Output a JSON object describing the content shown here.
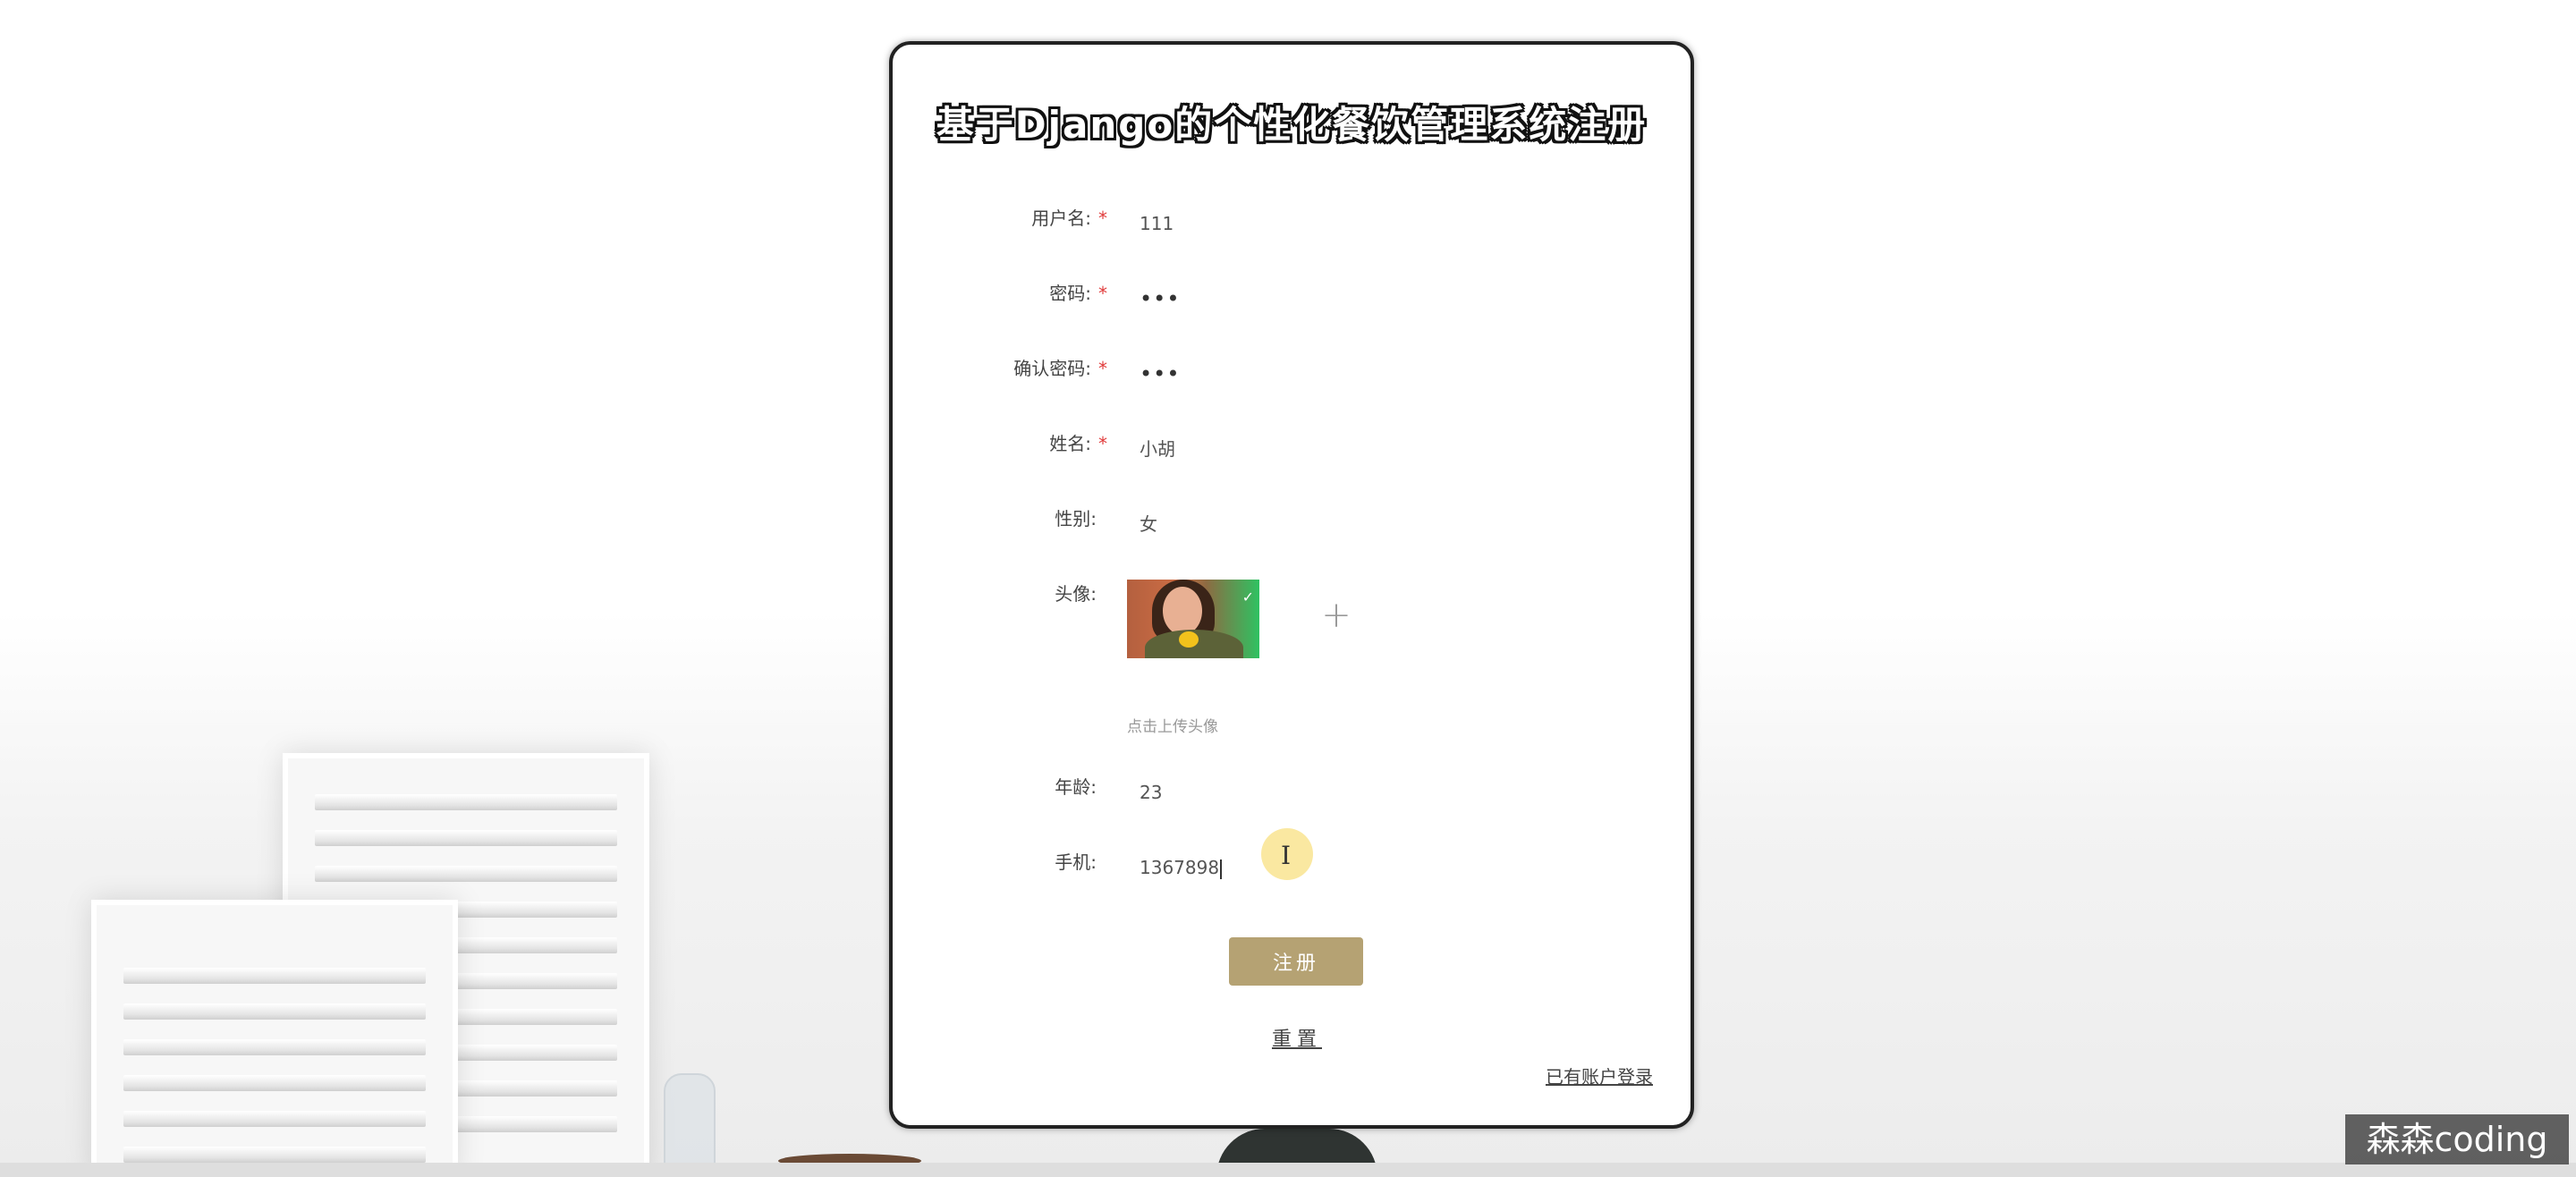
{
  "title": "基于Django的个性化餐饮管理系统注册",
  "form": {
    "username": {
      "label": "用户名:",
      "required": "*",
      "value": "111"
    },
    "password": {
      "label": "密码:",
      "required": "*",
      "value": "•••"
    },
    "confirm_password": {
      "label": "确认密码:",
      "required": "*",
      "value": "•••"
    },
    "name": {
      "label": "姓名:",
      "required": "*",
      "value": "小胡"
    },
    "gender": {
      "label": "性别:",
      "value": "女"
    },
    "avatar": {
      "label": "头像:",
      "upload_icon": "plus-icon",
      "hint": "点击上传头像"
    },
    "age": {
      "label": "年龄:",
      "value": "23"
    },
    "phone": {
      "label": "手机:",
      "value": "1367898"
    }
  },
  "buttons": {
    "submit": "注册",
    "reset": "重置",
    "login_link": "已有账户登录"
  },
  "watermark": "森森coding",
  "colors": {
    "submit_bg": "#b5a273",
    "required": "#e03a3a"
  }
}
